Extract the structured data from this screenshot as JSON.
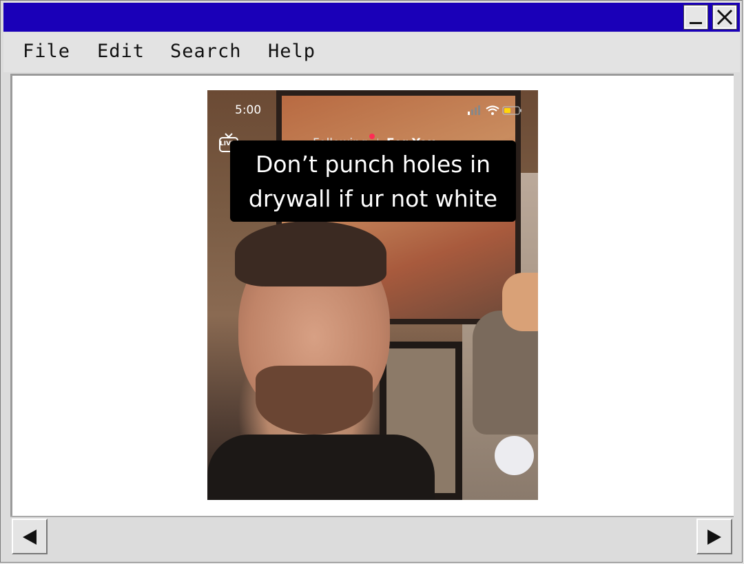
{
  "menu": {
    "file": "File",
    "edit": "Edit",
    "search": "Search",
    "help": "Help"
  },
  "phone": {
    "status_time": "5:00",
    "live_label": "LIVE",
    "tab_following": "Following",
    "tab_for_you": "For You",
    "caption_line1": "Don’t punch holes in",
    "caption_line2": "drywall if ur not white"
  },
  "colors": {
    "titlebar": "#1a00b8",
    "live_dot": "#fe2c55",
    "battery": "#ffd60a"
  },
  "icons": [
    "minimize-icon",
    "close-icon",
    "live-tv-icon",
    "signal-icon",
    "wifi-icon",
    "battery-icon",
    "arrow-left-icon",
    "arrow-right-icon"
  ]
}
